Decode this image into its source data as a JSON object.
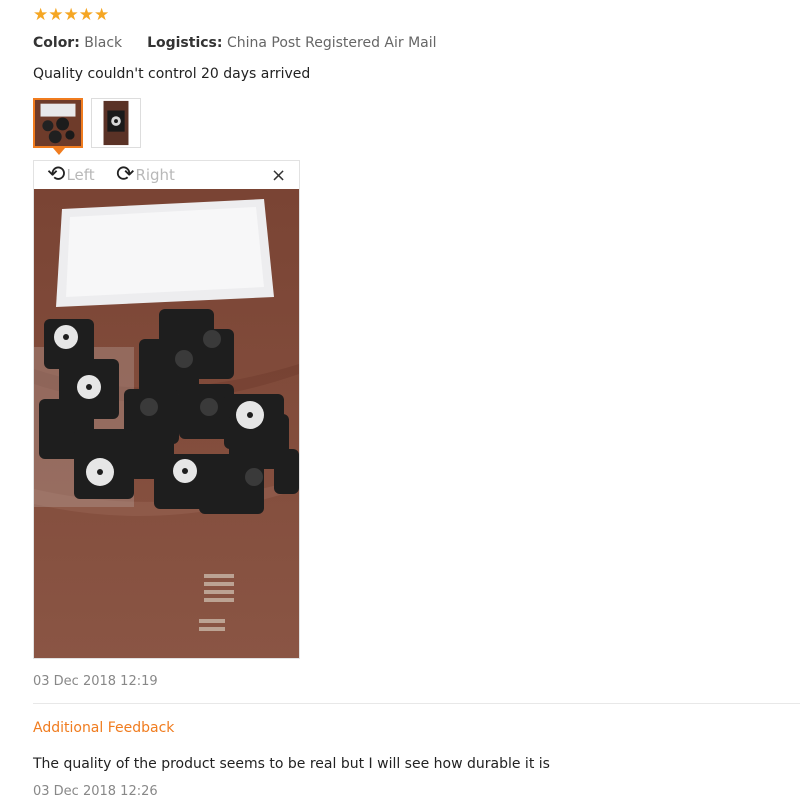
{
  "rating": {
    "stars": "★★★★★",
    "value": 5,
    "color": "#f5a623"
  },
  "attributes": {
    "color_label": "Color:",
    "color_value": "Black",
    "logistics_label": "Logistics:",
    "logistics_value": "China Post Registered Air Mail"
  },
  "review": {
    "text": "Quality couldn't control 20 days arrived",
    "date": "03 Dec 2018 12:19"
  },
  "viewer": {
    "rotate_left_icon": "rotate-left-icon",
    "rotate_left_label": "Left",
    "rotate_right_icon": "rotate-right-icon",
    "rotate_right_label": "Right",
    "close_glyph": "×"
  },
  "additional_feedback": {
    "title": "Additional Feedback",
    "text": "The quality of the product seems to be real but I will see how durable it is",
    "date": "03 Dec 2018 12:26"
  },
  "colors": {
    "accent": "#f07c1f",
    "muted_text": "#888888"
  }
}
